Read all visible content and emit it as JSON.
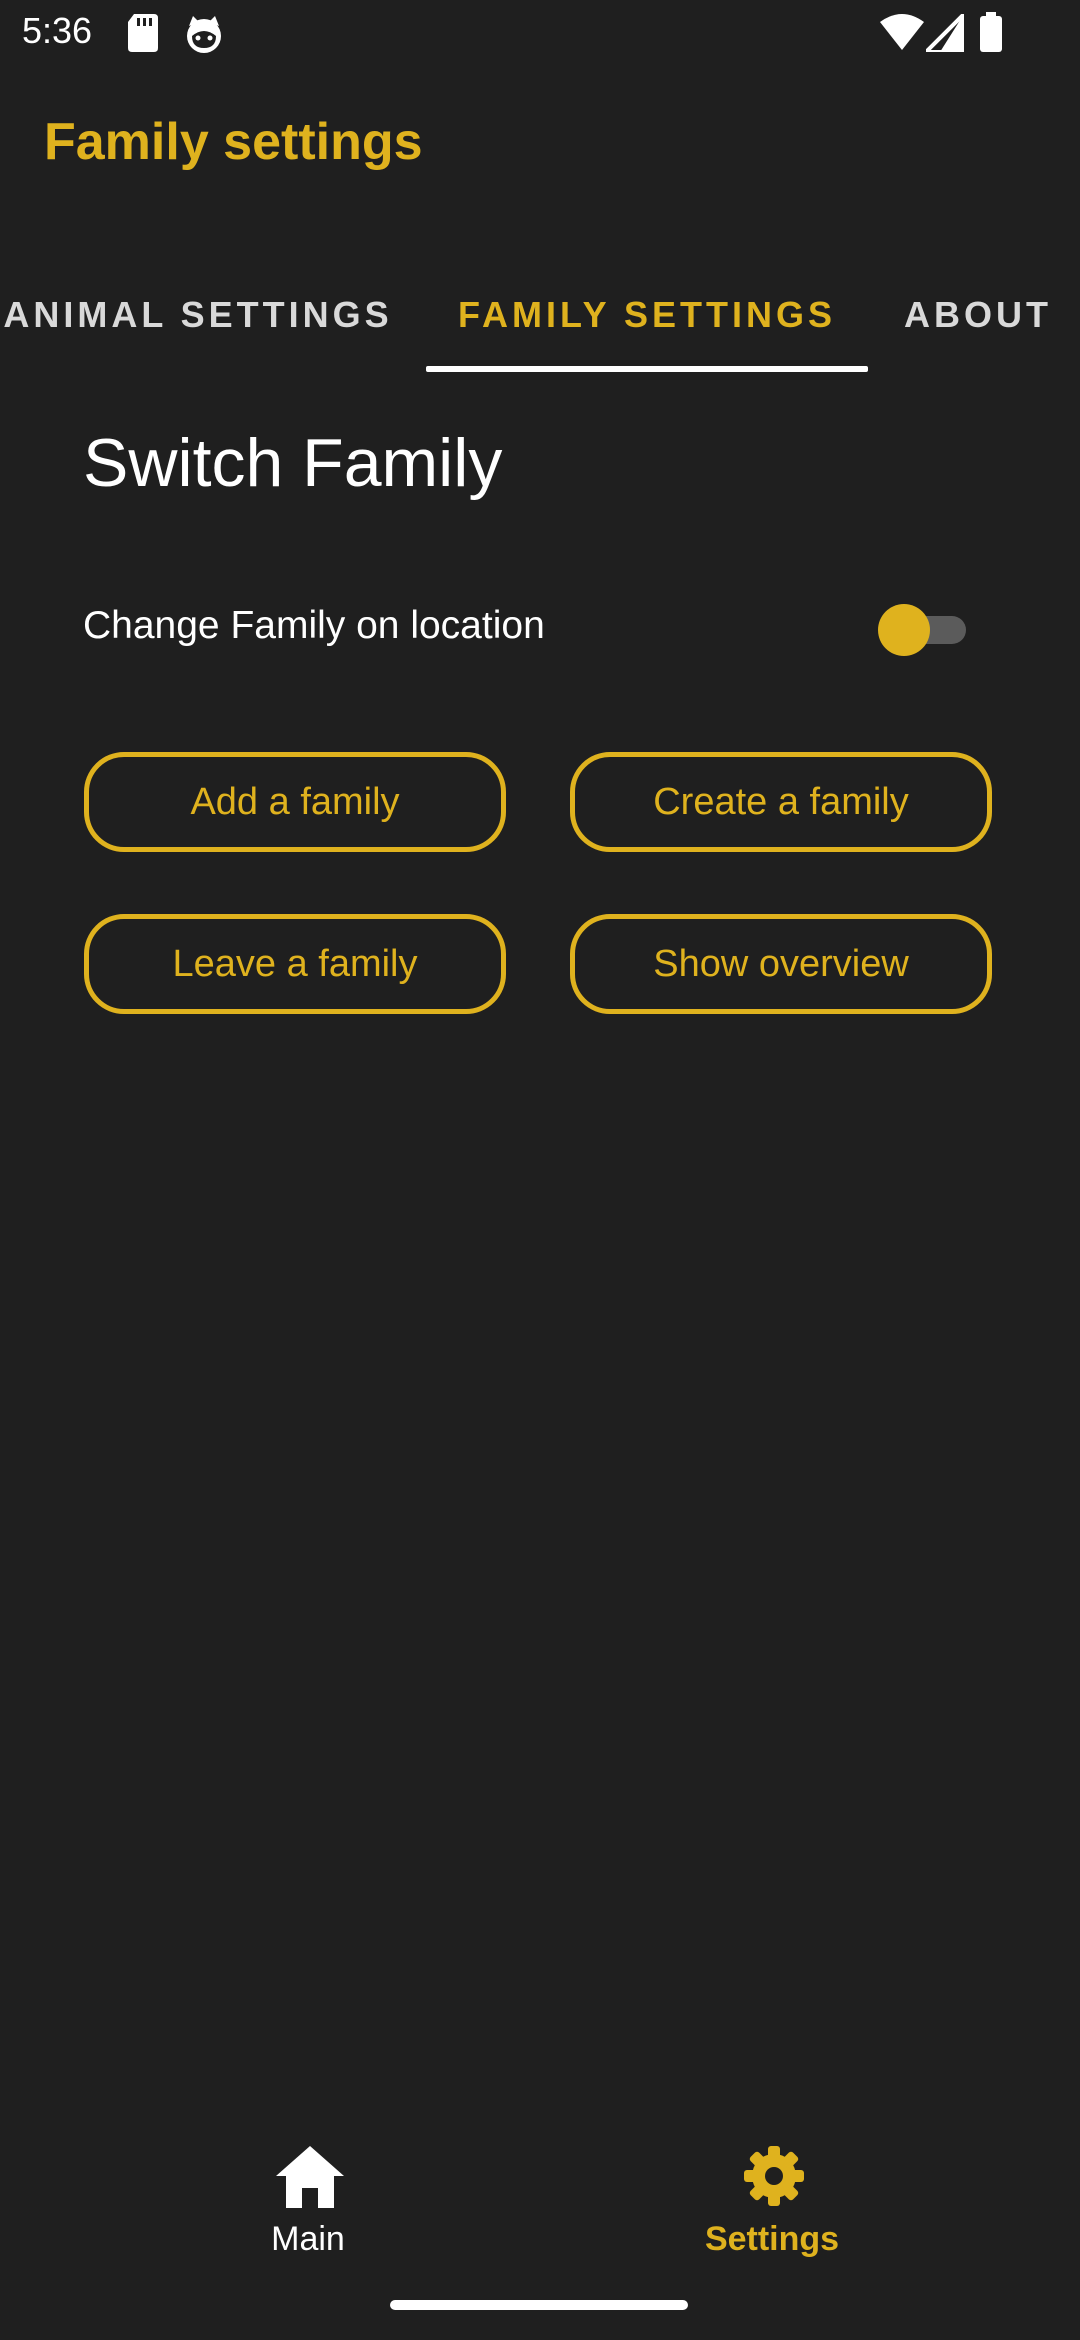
{
  "status_bar": {
    "time": "5:36",
    "icons": [
      "sd-card-icon",
      "cat-icon",
      "wifi-icon",
      "signal-icon",
      "battery-icon"
    ]
  },
  "app_bar": {
    "title": "Family settings"
  },
  "tabs": [
    {
      "label": "ANIMAL SETTINGS",
      "selected": false
    },
    {
      "label": "FAMILY SETTINGS",
      "selected": true
    },
    {
      "label": "ABOUT",
      "selected": false
    }
  ],
  "section": {
    "title": "Switch Family",
    "toggle_label": "Change Family on location",
    "toggle_on": false
  },
  "buttons": {
    "add": "Add a family",
    "create": "Create a family",
    "leave": "Leave a family",
    "overview": "Show overview"
  },
  "bottom_nav": {
    "items": [
      {
        "label": "Main",
        "icon": "home-icon",
        "selected": false
      },
      {
        "label": "Settings",
        "icon": "gear-icon",
        "selected": true
      }
    ]
  },
  "colors": {
    "accent": "#dfb21e",
    "background": "#1f1f1f",
    "text": "#ffffff"
  }
}
